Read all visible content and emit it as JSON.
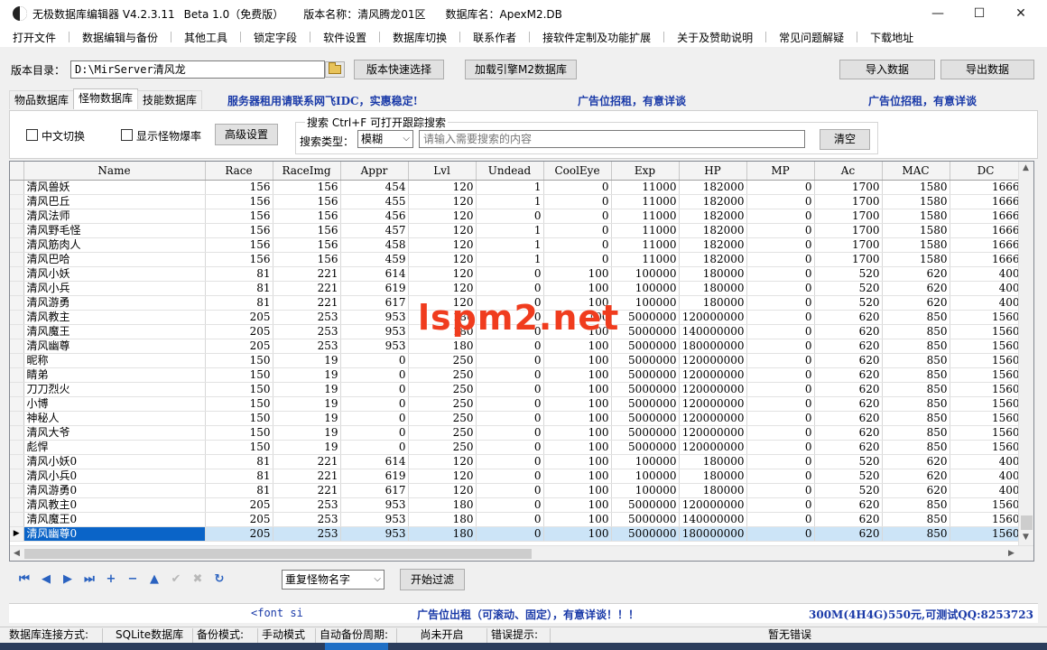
{
  "titlebar": {
    "title": "无极数据库编辑器 V4.2.3.11",
    "beta": "Beta 1.0（免费版）",
    "version_name": "版本名称：清风腾龙01区",
    "db_name": "数据库名：ApexM2.DB",
    "minimize": "—",
    "maximize": "☐",
    "close": "✕"
  },
  "menu": [
    "打开文件",
    "数据编辑与备份",
    "其他工具",
    "锁定字段",
    "软件设置",
    "数据库切换",
    "联系作者",
    "接软件定制及功能扩展",
    "关于及赞助说明",
    "常见问题解疑",
    "下载地址"
  ],
  "toolbar": {
    "dir_label": "版本目录：",
    "dir_value": "D:\\MirServer清风龙",
    "quick_select": "版本快速选择",
    "load_engine": "加载引擎M2数据库",
    "import": "导入数据",
    "export": "导出数据"
  },
  "tabs": [
    "物品数据库",
    "怪物数据库",
    "技能数据库"
  ],
  "ads": {
    "server": "服务器租用请联系网飞IDC，实惠稳定!",
    "ad1": "广告位招租，有意详谈",
    "ad2": "广告位招租，有意详谈"
  },
  "filter": {
    "chinese_label": "中文切换",
    "show_drops_label": "显示怪物爆率",
    "advanced": "高级设置",
    "search_title": "搜索  Ctrl+F 可打开跟踪搜索",
    "search_type_label": "搜索类型：",
    "search_type_value": "模糊",
    "search_placeholder": "请输入需要搜索的内容",
    "clear": "清空"
  },
  "grid": {
    "columns": [
      "Name",
      "Race",
      "RaceImg",
      "Appr",
      "Lvl",
      "Undead",
      "CoolEye",
      "Exp",
      "HP",
      "MP",
      "Ac",
      "MAC",
      "DC"
    ],
    "rows": [
      [
        "清风兽妖",
        "156",
        "156",
        "454",
        "120",
        "1",
        "0",
        "11000",
        "182000",
        "0",
        "1700",
        "1580",
        "1666"
      ],
      [
        "清风巴丘",
        "156",
        "156",
        "455",
        "120",
        "1",
        "0",
        "11000",
        "182000",
        "0",
        "1700",
        "1580",
        "1666"
      ],
      [
        "清风法师",
        "156",
        "156",
        "456",
        "120",
        "0",
        "0",
        "11000",
        "182000",
        "0",
        "1700",
        "1580",
        "1666"
      ],
      [
        "清风野毛怪",
        "156",
        "156",
        "457",
        "120",
        "1",
        "0",
        "11000",
        "182000",
        "0",
        "1700",
        "1580",
        "1666"
      ],
      [
        "清风筋肉人",
        "156",
        "156",
        "458",
        "120",
        "1",
        "0",
        "11000",
        "182000",
        "0",
        "1700",
        "1580",
        "1666"
      ],
      [
        "清风巴哈",
        "156",
        "156",
        "459",
        "120",
        "1",
        "0",
        "11000",
        "182000",
        "0",
        "1700",
        "1580",
        "1666"
      ],
      [
        "清风小妖",
        "81",
        "221",
        "614",
        "120",
        "0",
        "100",
        "100000",
        "180000",
        "0",
        "520",
        "620",
        "400"
      ],
      [
        "清风小兵",
        "81",
        "221",
        "619",
        "120",
        "0",
        "100",
        "100000",
        "180000",
        "0",
        "520",
        "620",
        "400"
      ],
      [
        "清风游勇",
        "81",
        "221",
        "617",
        "120",
        "0",
        "100",
        "100000",
        "180000",
        "0",
        "520",
        "620",
        "400"
      ],
      [
        "清风教主",
        "205",
        "253",
        "953",
        "180",
        "0",
        "100",
        "5000000",
        "120000000",
        "0",
        "620",
        "850",
        "1560"
      ],
      [
        "清风魔王",
        "205",
        "253",
        "953",
        "180",
        "0",
        "100",
        "5000000",
        "140000000",
        "0",
        "620",
        "850",
        "1560"
      ],
      [
        "清风幽尊",
        "205",
        "253",
        "953",
        "180",
        "0",
        "100",
        "5000000",
        "180000000",
        "0",
        "620",
        "850",
        "1560"
      ],
      [
        "昵称",
        "150",
        "19",
        "0",
        "250",
        "0",
        "100",
        "5000000",
        "120000000",
        "0",
        "620",
        "850",
        "1560"
      ],
      [
        "睛弟",
        "150",
        "19",
        "0",
        "250",
        "0",
        "100",
        "5000000",
        "120000000",
        "0",
        "620",
        "850",
        "1560"
      ],
      [
        "刀刀烈火",
        "150",
        "19",
        "0",
        "250",
        "0",
        "100",
        "5000000",
        "120000000",
        "0",
        "620",
        "850",
        "1560"
      ],
      [
        "小博",
        "150",
        "19",
        "0",
        "250",
        "0",
        "100",
        "5000000",
        "120000000",
        "0",
        "620",
        "850",
        "1560"
      ],
      [
        "神秘人",
        "150",
        "19",
        "0",
        "250",
        "0",
        "100",
        "5000000",
        "120000000",
        "0",
        "620",
        "850",
        "1560"
      ],
      [
        "清风大爷",
        "150",
        "19",
        "0",
        "250",
        "0",
        "100",
        "5000000",
        "120000000",
        "0",
        "620",
        "850",
        "1560"
      ],
      [
        "彪悍",
        "150",
        "19",
        "0",
        "250",
        "0",
        "100",
        "5000000",
        "120000000",
        "0",
        "620",
        "850",
        "1560"
      ],
      [
        "清风小妖0",
        "81",
        "221",
        "614",
        "120",
        "0",
        "100",
        "100000",
        "180000",
        "0",
        "520",
        "620",
        "400"
      ],
      [
        "清风小兵0",
        "81",
        "221",
        "619",
        "120",
        "0",
        "100",
        "100000",
        "180000",
        "0",
        "520",
        "620",
        "400"
      ],
      [
        "清风游勇0",
        "81",
        "221",
        "617",
        "120",
        "0",
        "100",
        "100000",
        "180000",
        "0",
        "520",
        "620",
        "400"
      ],
      [
        "清风教主0",
        "205",
        "253",
        "953",
        "180",
        "0",
        "100",
        "5000000",
        "120000000",
        "0",
        "620",
        "850",
        "1560"
      ],
      [
        "清风魔王0",
        "205",
        "253",
        "953",
        "180",
        "0",
        "100",
        "5000000",
        "140000000",
        "0",
        "620",
        "850",
        "1560"
      ],
      [
        "清风幽尊0",
        "205",
        "253",
        "953",
        "180",
        "0",
        "100",
        "5000000",
        "180000000",
        "0",
        "620",
        "850",
        "1560"
      ]
    ],
    "selected_row": 24,
    "row_indicator": "▶"
  },
  "watermark": "lspm2.net",
  "nav": {
    "icons": [
      {
        "name": "first-record-icon",
        "glyph": "⏮",
        "enabled": true
      },
      {
        "name": "prior-record-icon",
        "glyph": "◀",
        "enabled": true
      },
      {
        "name": "next-record-icon",
        "glyph": "▶",
        "enabled": true
      },
      {
        "name": "last-record-icon",
        "glyph": "⏭",
        "enabled": true
      },
      {
        "name": "insert-record-icon",
        "glyph": "+",
        "enabled": true
      },
      {
        "name": "delete-record-icon",
        "glyph": "−",
        "enabled": true
      },
      {
        "name": "edit-record-icon",
        "glyph": "▲",
        "enabled": true
      },
      {
        "name": "post-record-icon",
        "glyph": "✔",
        "enabled": false
      },
      {
        "name": "cancel-record-icon",
        "glyph": "✖",
        "enabled": false
      },
      {
        "name": "refresh-record-icon",
        "glyph": "↻",
        "enabled": true
      }
    ],
    "dup_select": "重复怪物名字",
    "start_filter": "开始过滤"
  },
  "footer": {
    "font_text": "<font si",
    "ad_center": "广告位出租（可滚动、固定），有意详谈！！！",
    "ad_right": "300M(4H4G)550元,可测试QQ:8253723"
  },
  "status": {
    "conn_label": "数据库连接方式:",
    "conn_value": "SQLite数据库",
    "backup_label": "备份模式:",
    "backup_value": "手动模式",
    "auto_label": "自动备份周期:",
    "auto_value": "尚未开启",
    "err_label": "错误提示:",
    "err_value": "暂无错误"
  },
  "colors": {
    "accent_blue": "#1a3aa8",
    "selection": "#0a64c8",
    "watermark": "#f03c1e"
  }
}
